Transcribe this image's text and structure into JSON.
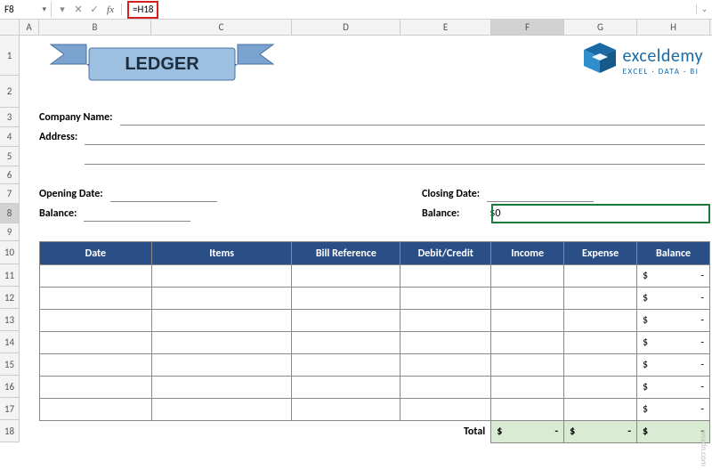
{
  "formula_bar": {
    "cell_ref": "F8",
    "formula": "=H18"
  },
  "columns": {
    "A": "A",
    "B": "B",
    "C": "C",
    "D": "D",
    "E": "E",
    "F": "F",
    "G": "G",
    "H": "H"
  },
  "rows": {
    "r1": "1",
    "r2": "2",
    "r3": "3",
    "r4": "4",
    "r5": "5",
    "r6": "6",
    "r7": "7",
    "r8": "8",
    "r9": "9",
    "r10": "10",
    "r11": "11",
    "r12": "12",
    "r13": "13",
    "r14": "14",
    "r15": "15",
    "r16": "16",
    "r17": "17",
    "r18": "18"
  },
  "banner": {
    "title": "LEDGER"
  },
  "logo": {
    "main": "exceldemy",
    "sub": "EXCEL · DATA · BI"
  },
  "form": {
    "company_label": "Company Name:",
    "address_label": "Address:",
    "opening_date_label": "Opening Date:",
    "closing_date_label": "Closing Date:",
    "balance_label_left": "Balance:",
    "balance_label_right": "Balance:",
    "balance_value_right": "$0"
  },
  "table": {
    "headers": {
      "date": "Date",
      "items": "Items",
      "bill": "Bill Reference",
      "dc": "Debit/Credit",
      "income": "Income",
      "expense": "Expense",
      "balance": "Balance"
    },
    "balance_cell": {
      "sym": "$",
      "dash": "-"
    },
    "total_label": "Total",
    "total_cells": {
      "sym": "$",
      "dash": "-"
    }
  },
  "watermark": "wsxdn.com"
}
